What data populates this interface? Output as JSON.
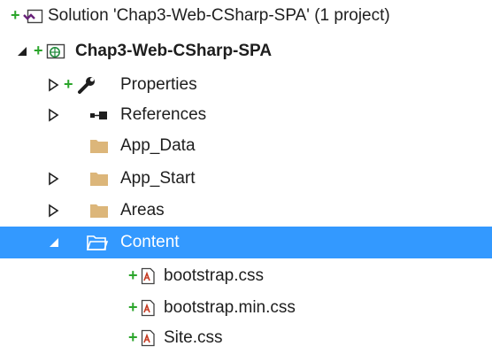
{
  "solution_explorer": {
    "solution": {
      "label": "Solution 'Chap3-Web-CSharp-SPA' (1 project)"
    },
    "project": {
      "label": "Chap3-Web-CSharp-SPA"
    },
    "items": [
      {
        "label": "Properties"
      },
      {
        "label": "References"
      },
      {
        "label": "App_Data"
      },
      {
        "label": "App_Start"
      },
      {
        "label": "Areas"
      },
      {
        "label": "Content"
      }
    ],
    "content_files": [
      {
        "label": "bootstrap.css"
      },
      {
        "label": "bootstrap.min.css"
      },
      {
        "label": "Site.css"
      }
    ],
    "pending_add_marker": "+",
    "colors": {
      "selection": "#3399ff",
      "folder": "#dcb67a",
      "pending_add": "#2ba52b"
    }
  }
}
